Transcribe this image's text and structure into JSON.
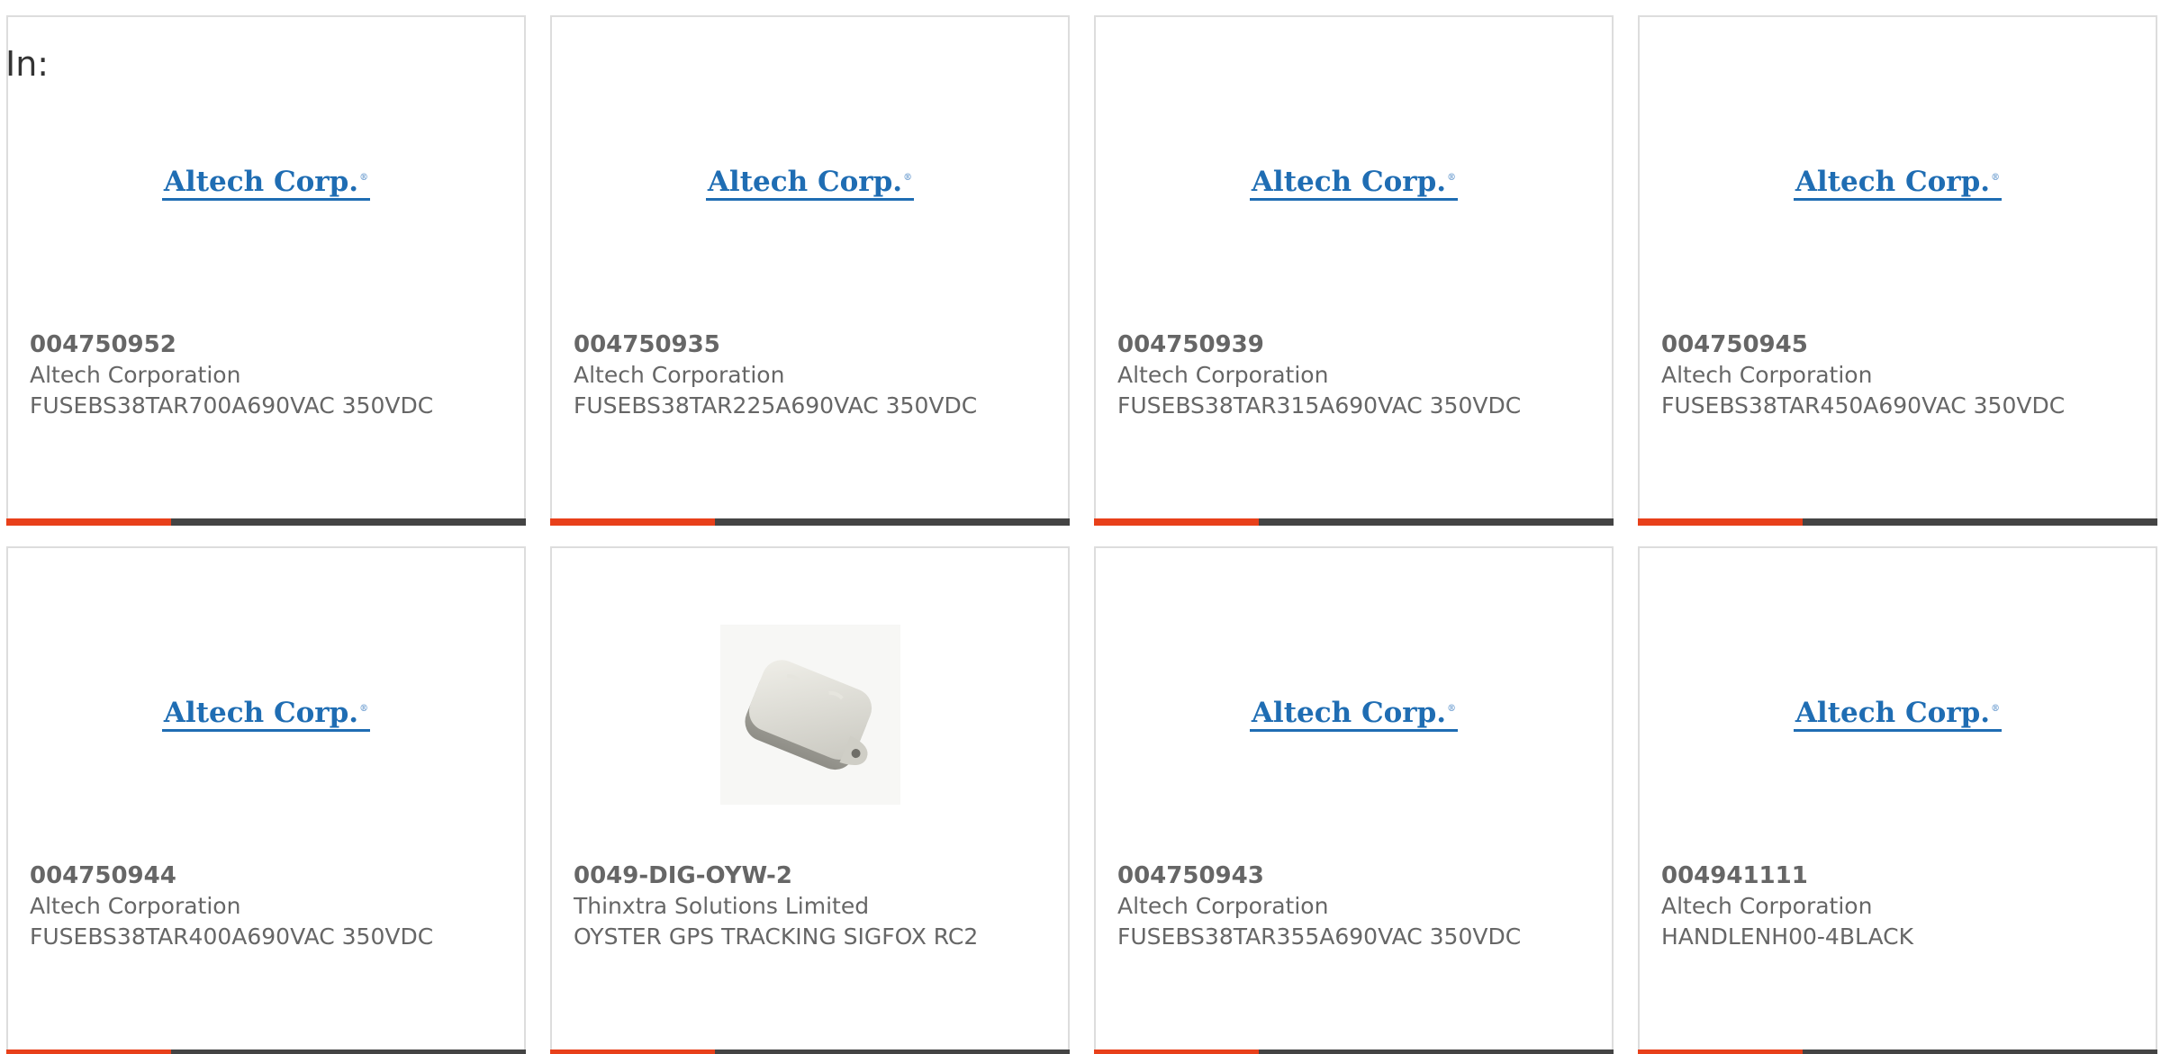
{
  "filter_label": "In:",
  "products": [
    {
      "part_number": "004750952",
      "manufacturer": "Altech Corporation",
      "description": "FUSEBS38TAR700A690VAC 350VDC",
      "image": "altech-logo"
    },
    {
      "part_number": "004750935",
      "manufacturer": "Altech Corporation",
      "description": "FUSEBS38TAR225A690VAC 350VDC",
      "image": "altech-logo"
    },
    {
      "part_number": "004750939",
      "manufacturer": "Altech Corporation",
      "description": "FUSEBS38TAR315A690VAC 350VDC",
      "image": "altech-logo"
    },
    {
      "part_number": "004750945",
      "manufacturer": "Altech Corporation",
      "description": "FUSEBS38TAR450A690VAC 350VDC",
      "image": "altech-logo"
    },
    {
      "part_number": "004750944",
      "manufacturer": "Altech Corporation",
      "description": "FUSEBS38TAR400A690VAC 350VDC",
      "image": "altech-logo"
    },
    {
      "part_number": "0049-DIG-OYW-2",
      "manufacturer": "Thinxtra Solutions Limited",
      "description": "OYSTER GPS TRACKING SIGFOX RC2",
      "image": "gps-tracker-photo"
    },
    {
      "part_number": "004750943",
      "manufacturer": "Altech Corporation",
      "description": "FUSEBS38TAR355A690VAC 350VDC",
      "image": "altech-logo"
    },
    {
      "part_number": "004941111",
      "manufacturer": "Altech Corporation",
      "description": "HANDLENH00-4BLACK",
      "image": "altech-logo"
    }
  ],
  "logo_text": "Altech Corp.",
  "logo_mark": "®",
  "colors": {
    "accent": "#e8401a",
    "bar": "#444444",
    "logo_blue": "#1f6db3",
    "text": "#666666",
    "border": "#dddddd"
  }
}
